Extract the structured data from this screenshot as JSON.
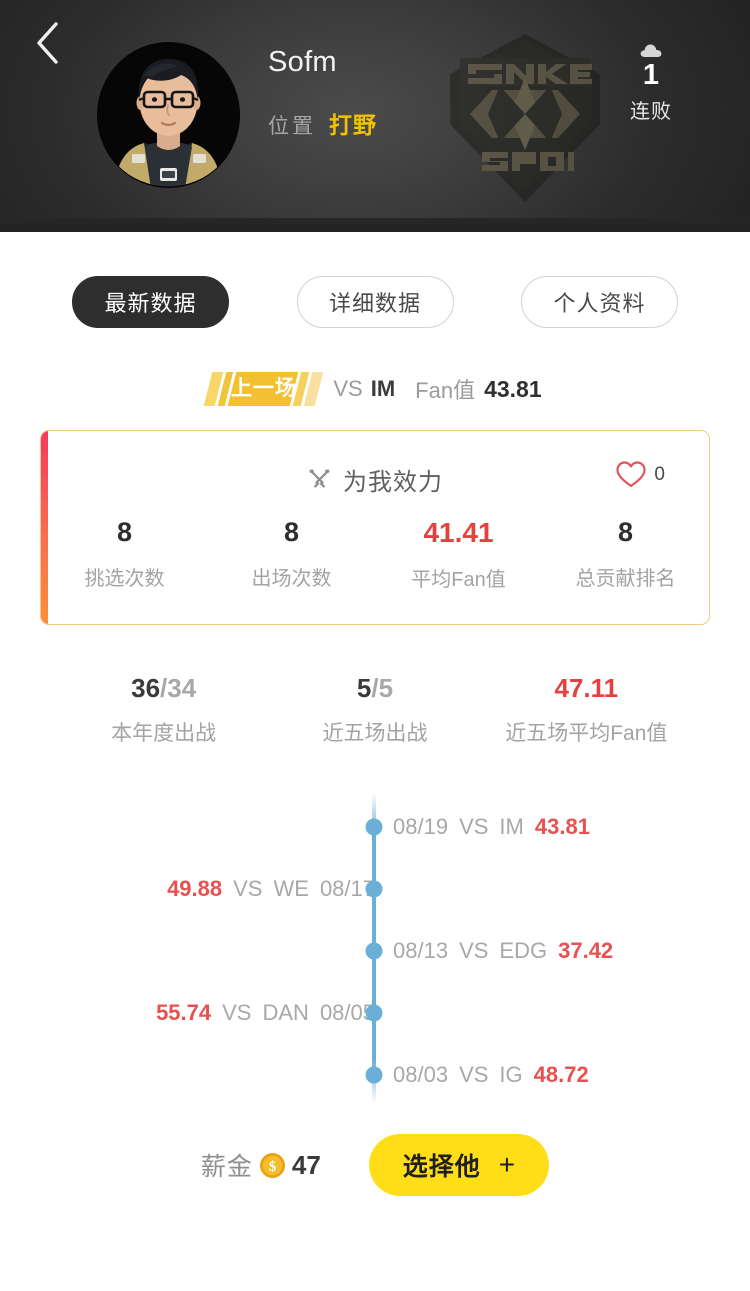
{
  "header": {
    "back_icon": "chevron-left-icon",
    "avatar_alt": "player-avatar",
    "player_name": "Sofm",
    "position_label": "位置",
    "position_value": "打野",
    "team_logo_text": "SNAKE ESPORTS",
    "streak_icon": "cloud-icon",
    "streak_count": "1",
    "streak_label": "连败",
    "accent_yellow": "#f2c200"
  },
  "tabs": [
    {
      "label": "最新数据",
      "active": true
    },
    {
      "label": "详细数据",
      "active": false
    },
    {
      "label": "个人资料",
      "active": false
    }
  ],
  "last_match": {
    "badge": "上一场",
    "vs": "VS",
    "opponent": "IM",
    "fan_label": "Fan值",
    "fan_value": "43.81"
  },
  "card": {
    "icon": "crossed-swords-icon",
    "title": "为我效力",
    "like_icon": "heart-outline-icon",
    "like_count": "0",
    "accent_gradient": [
      "#f4395f",
      "#f98f3b"
    ],
    "border_color": "#f3c988",
    "stats": [
      {
        "value": "8",
        "label": "挑选次数",
        "red": false
      },
      {
        "value": "8",
        "label": "出场次数",
        "red": false
      },
      {
        "value": "41.41",
        "label": "平均Fan值",
        "red": true
      },
      {
        "value": "8",
        "label": "总贡献排名",
        "red": false
      }
    ]
  },
  "mini_stats": [
    {
      "value": "36",
      "suffix": "/34",
      "label": "本年度出战",
      "red": false
    },
    {
      "value": "5",
      "suffix": "/5",
      "label": "近五场出战",
      "red": false
    },
    {
      "value": "47.11",
      "suffix": "",
      "label": "近五场平均Fan值",
      "red": true
    }
  ],
  "timeline": {
    "dot_color": "#6aafd6",
    "value_color": "#e8514f",
    "vs": "VS",
    "items": [
      {
        "date": "08/19",
        "opponent": "IM",
        "value": "43.81",
        "side": "right"
      },
      {
        "date": "08/17",
        "opponent": "WE",
        "value": "49.88",
        "side": "left"
      },
      {
        "date": "08/13",
        "opponent": "EDG",
        "value": "37.42",
        "side": "right"
      },
      {
        "date": "08/05",
        "opponent": "DAN",
        "value": "55.74",
        "side": "left"
      },
      {
        "date": "08/03",
        "opponent": "IG",
        "value": "48.72",
        "side": "right"
      }
    ]
  },
  "footer": {
    "salary_label": "薪金",
    "coin_icon": "gold-coin-icon",
    "salary_value": "47",
    "pick_label": "选择他",
    "plus_icon": "plus-icon",
    "button_color": "#ffde17"
  }
}
